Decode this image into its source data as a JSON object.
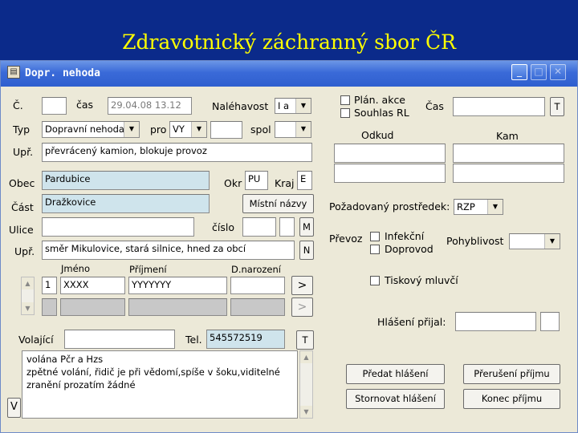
{
  "slide": {
    "title": "Zdravotnický záchranný sbor ČR"
  },
  "window": {
    "title": "Dopr. nehoda",
    "app_icon": "form-icon",
    "minimize": "_",
    "maximize": "□",
    "close": "✕"
  },
  "form": {
    "c_label": "Č.",
    "cas_label": "čas",
    "cas_value": "29.04.08 13.12",
    "nalehavost_label": "Naléhavost",
    "nalehavost_value": "I a",
    "typ_label": "Typ",
    "typ_value": "Dopravní nehoda",
    "pro_label": "pro",
    "pro_value": "VY",
    "spol_label": "spol",
    "upr_label": "Upř.",
    "upr_value": "převrácený kamion, blokuje provoz",
    "obec_label": "Obec",
    "obec_value": "Pardubice",
    "okr_label": "Okr",
    "okr_value": "PU",
    "kraj_label": "Kraj",
    "kraj_value": "E",
    "cast_label": "Část",
    "cast_value": "Dražkovice",
    "mistni_button": "Místní názvy",
    "ulice_label": "Ulice",
    "cislo_label": "číslo",
    "m_button": "M",
    "upr2_label": "Upř.",
    "upr2_value": "směr Mikulovice, stará silnice, hned za obcí",
    "n_button": "N",
    "jmeno_header": "Jméno",
    "prijmeni_header": "Příjmení",
    "dnar_header": "D.narození",
    "row1_num": "1",
    "row1_jmeno": "XXXX",
    "row1_prijmeni": "YYYYYYY",
    "next_button": ">",
    "next2_button": ">",
    "volajici_label": "Volající",
    "tel_label": "Tel.",
    "tel_value": "545572519",
    "t_button": "T",
    "v_button": "V",
    "memo_line1": "volána Pčr a Hzs",
    "memo_line2": "zpětné volání, řidič je při vědomí,spíše v šoku,viditelné",
    "memo_line3": "zranění prozatím žádné"
  },
  "right": {
    "plan_akce": "Plán. akce",
    "souhlas_rl": "Souhlas RL",
    "cas_label": "Čas",
    "t_button": "T",
    "odkud_header": "Odkud",
    "kam_header": "Kam",
    "pozadovany_label": "Požadovaný prostředek:",
    "pozadovany_value": "RZP",
    "prevoz_label": "Převoz",
    "infekcni": "Infekční",
    "doprovod": "Doprovod",
    "pohyblivost_label": "Pohyblivost",
    "tiskovy": "Tiskový mluvčí",
    "hlaseni_prijal": "Hlášení přijal:"
  },
  "buttons": {
    "predat": "Předat hlášení",
    "preruseni": "Přerušení příjmu",
    "stornovat": "Stornovat hlášení",
    "konec": "Konec příjmu"
  },
  "colors": {
    "background": "#0b2a8a",
    "title": "#ffff00",
    "window": "#ece9d8",
    "highlight_field": "#cfe4ec"
  }
}
